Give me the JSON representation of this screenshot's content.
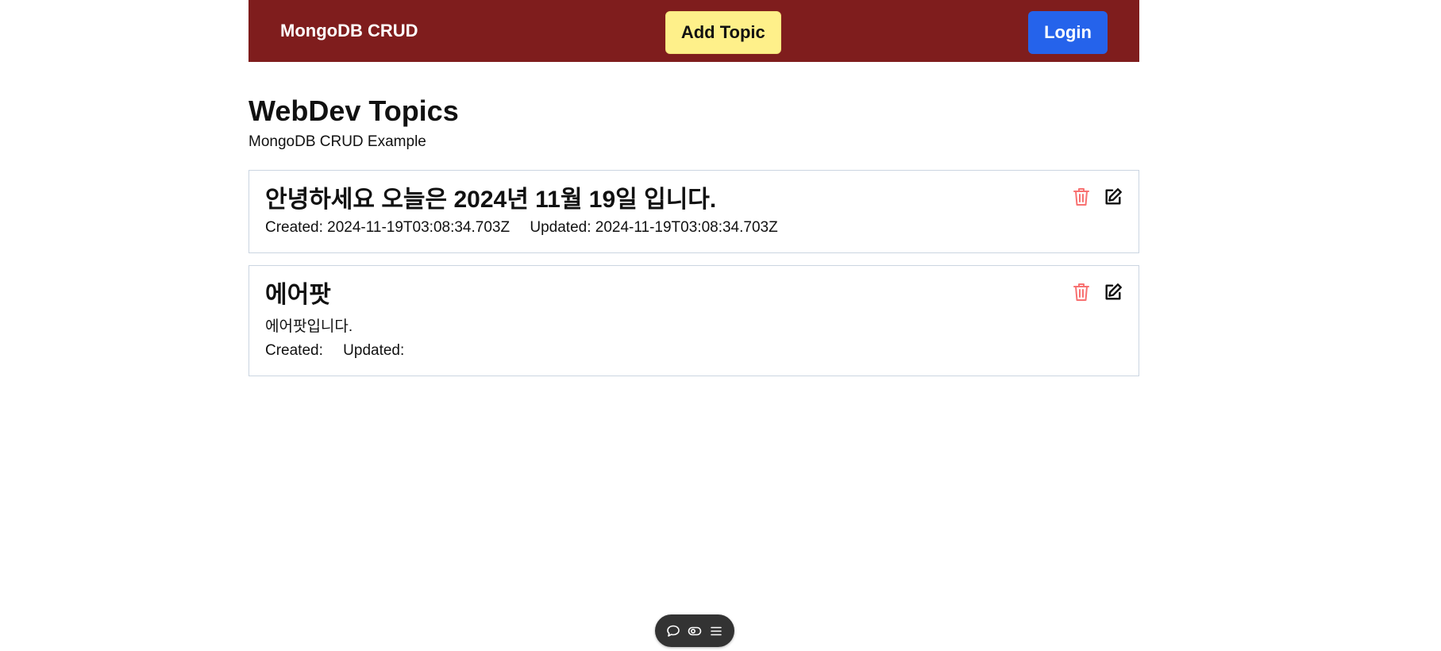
{
  "navbar": {
    "brand": "MongoDB CRUD",
    "add_label": "Add Topic",
    "login_label": "Login",
    "bg_color": "#7f1d1d"
  },
  "page": {
    "title": "WebDev Topics",
    "subtitle": "MongoDB CRUD Example"
  },
  "topics": [
    {
      "title": "안녕하세요 오늘은 2024년 11월 19일 입니다.",
      "description": "",
      "created": "Created: 2024-11-19T03:08:34.703Z",
      "updated": "Updated: 2024-11-19T03:08:34.703Z"
    },
    {
      "title": "에어팟",
      "description": "에어팟입니다.",
      "created": "Created:",
      "updated": "Updated:"
    }
  ],
  "icons": {
    "delete": "trash-icon",
    "edit": "edit-icon",
    "toolbar": [
      "comment-icon",
      "toggle-icon",
      "menu-icon"
    ]
  },
  "colors": {
    "delete_icon": "#f87171",
    "edit_icon": "#111111",
    "add_button": "#fef08a",
    "login_button": "#2563eb"
  }
}
